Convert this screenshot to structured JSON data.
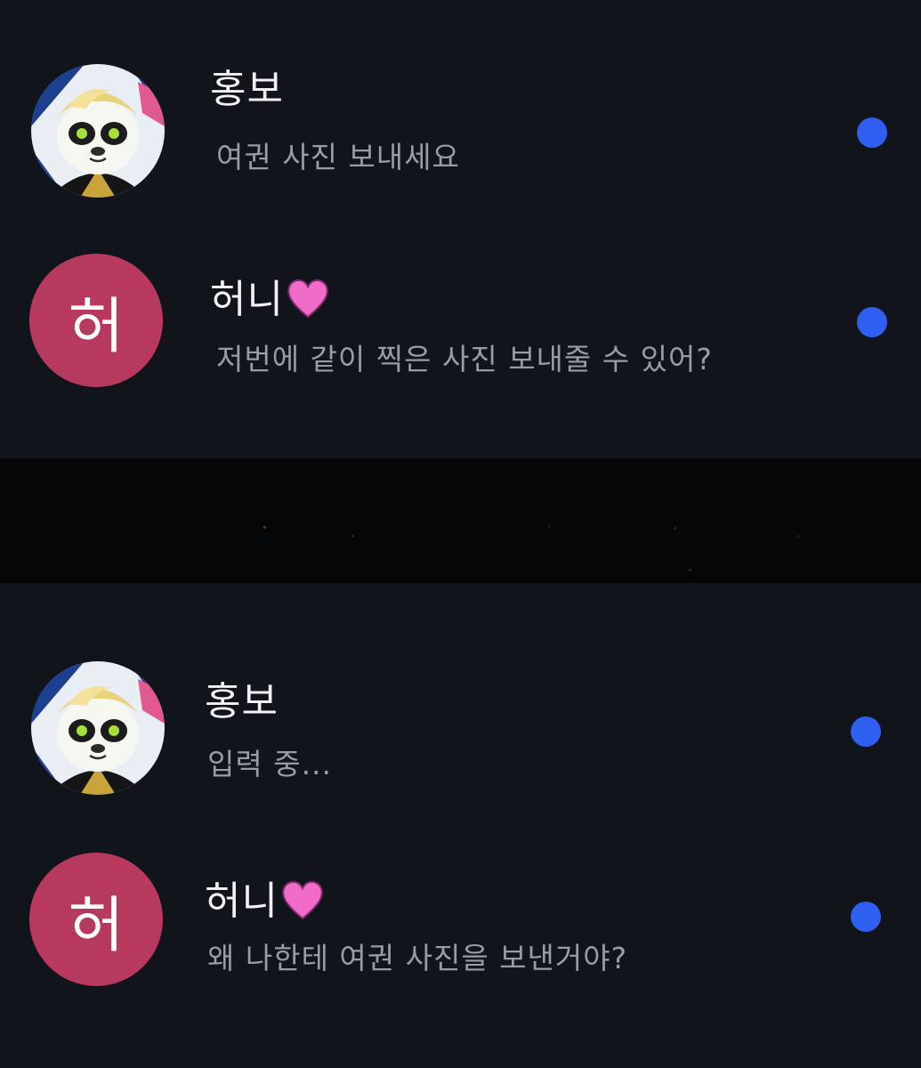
{
  "colors": {
    "background": "#11141b",
    "divider": "#050608",
    "name_text": "#f2f2f4",
    "preview_text": "#9a9ca3",
    "unread_dot": "#2f5ff0",
    "letter_avatar": "#b73a5e",
    "heart": "#f06cc8"
  },
  "top_list": {
    "conversations": [
      {
        "name": "홍보",
        "preview": "여권 사진 보내세요",
        "avatar": "panda-character-icon",
        "unread": true
      },
      {
        "name": "허니",
        "name_suffix_icon": "pink-heart-icon",
        "preview": "저번에 같이 찍은 사진 보내줄 수 있어?",
        "avatar_letter": "허",
        "unread": true
      }
    ]
  },
  "bottom_list": {
    "conversations": [
      {
        "name": "홍보",
        "preview": "입력 중...",
        "avatar": "panda-character-icon",
        "unread": true
      },
      {
        "name": "허니",
        "name_suffix_icon": "pink-heart-icon",
        "preview": "왜 나한테 여권 사진을 보낸거야?",
        "avatar_letter": "허",
        "unread": true
      }
    ]
  }
}
